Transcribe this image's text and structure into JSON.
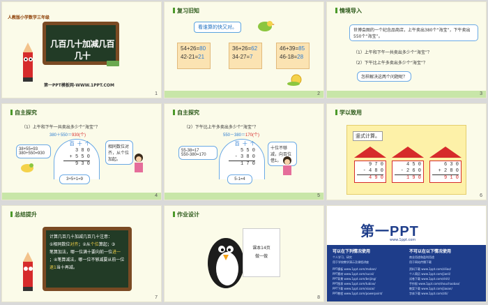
{
  "slides": {
    "s1": {
      "num": "1",
      "brand": "人教版小学数学三年级",
      "board_title": "几百几十加减几百几十",
      "site": "第一PPT模板网-WWW.1PPT.COM"
    },
    "s2": {
      "num": "2",
      "title": "复习旧知",
      "tag": "看谁算的快又对。",
      "cards": [
        {
          "q1": "54+26=",
          "a1": "80",
          "q2": "42-21=",
          "a2": "21"
        },
        {
          "q1": "36+26=",
          "a1": "62",
          "q2": "34-27=",
          "a2": "7"
        },
        {
          "q1": "46+39=",
          "a1": "85",
          "q2": "46-18=",
          "a2": "28"
        }
      ]
    },
    "s3": {
      "num": "3",
      "title": "情境导入",
      "story": "世博会图的一个纪念品商店，上午卖出380个“海宝”，下午卖出550个“海宝”。",
      "q1": "（1）上午和下午一共卖出多少个“海宝”？",
      "q2": "（2）下午比上午多卖出多少个“海宝”？",
      "ask": "怎样解决这两个问题呢？"
    },
    "s4": {
      "num": "4",
      "title": "自主探究",
      "question": "（1）上午和下午一共卖出多少个“海宝”？",
      "eq_left": "380＋550＝",
      "eq_ans": "930(个)",
      "calc_a": "38+55=93",
      "calc_b": "380+550=930",
      "col_head": "百 十 个",
      "row1": "3 8 0",
      "row2": "+ 5 5 0",
      "row3": "9 3 0",
      "hint": "相同数位对齐，从个位加起。",
      "carry": "3+5+1=9"
    },
    "s5": {
      "num": "5",
      "title": "自主探究",
      "question": "（2）下午比上午多卖出多少个“海宝”？",
      "eq_left": "550－380＝",
      "eq_ans": "170(个)",
      "calc_a": "55-38=17",
      "calc_b": "550-380=170",
      "col_head": "百 十 个",
      "row1": "5 5 0",
      "row2": "- 3 8 0",
      "row3": "1 7 0",
      "hint": "十位不够减，向百位借1。",
      "borrow": "5-1=4"
    },
    "s6": {
      "num": "6",
      "title": "学以致用",
      "label": "竖式计算。",
      "problems": [
        {
          "a": "9 7 0",
          "b": "- 4 8 0",
          "r": "4 9 0"
        },
        {
          "a": "4 5 0",
          "b": "- 2 6 0",
          "r": "1 9 0"
        },
        {
          "a": "6 3 0",
          "b": "+ 2 8 0",
          "r": "9 1 0"
        }
      ]
    },
    "s7": {
      "num": "7",
      "title": "总结提升",
      "l1": "计算几百几十加减几百几十注意：",
      "l2a": "①相同数位",
      "l2b": "对齐",
      "l2c": "；②从",
      "l2d": "个位",
      "l2e": "算起；③",
      "l3a": "笔算加法，哪一位满十要向前一位",
      "l3b": "进一",
      "l4a": "；④笔算减法，哪一位不够减要从前一位",
      "l4b": "退1",
      "l4c": "当十再减。"
    },
    "s8": {
      "num": "8",
      "title": "作业设计",
      "note1": "课本14页",
      "note2": "做一做"
    },
    "s9": {
      "logo": "第一PPT",
      "url": "www.1ppt.com",
      "left_title": "可以在下列情况使用",
      "right_title": "不可以在以下情况使用",
      "left_rows": [
        "个人学习、研究",
        "用于学校教学演示及课程讲座",
        "PPT模板 www.1ppt.com/moban/",
        "PPT素材 www.1ppt.com/sucai/",
        "PPT背景 www.1ppt.com/beijing/",
        "PPT图表 www.1ppt.com/tubiao/",
        "PPT下载 www.1ppt.com/xiazai/",
        "PPT教程 www.1ppt.com/powerpoint/"
      ],
      "right_rows": [
        "商业用途和盈利用途",
        "用于网站传播下载",
        "资料下载 www.1ppt.com/ziliao/",
        "个人简历 www.1ppt.com/jianli/",
        "试卷下载 www.1ppt.com/shiti/",
        "手抄报 www.1ppt.com/shouchaobao/",
        "教案下载 www.1ppt.com/jiaoan/",
        "字体下载 www.1ppt.com/ziti/"
      ]
    }
  },
  "colors": {
    "accent_blue": "#2b7bd0",
    "accent_red": "#d62b2b",
    "header_green": "#c8e6a8",
    "board": "#223b26"
  }
}
